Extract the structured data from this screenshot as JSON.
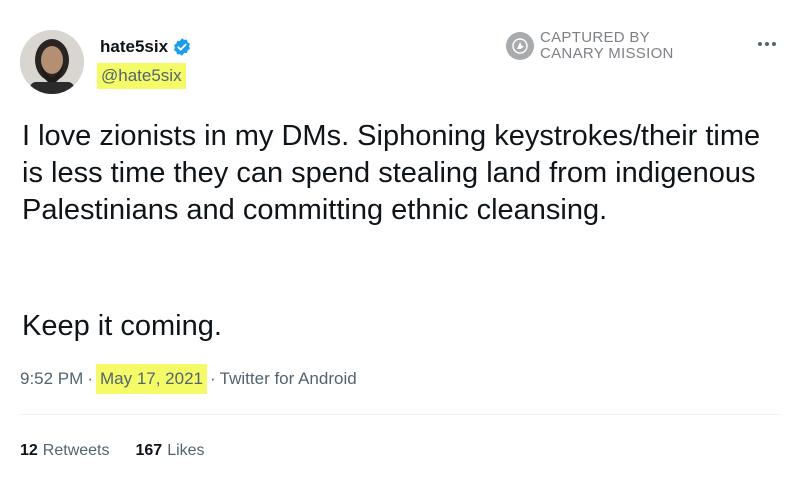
{
  "tweet": {
    "author": {
      "display_name": "hate5six",
      "handle": "@hate5six",
      "verified": true,
      "verified_icon": "verified-badge-icon",
      "verified_color": "#1d9bf0"
    },
    "watermark": {
      "line1": "CAPTURED BY",
      "line2": "CANARY MISSION",
      "icon": "canary-bird-icon"
    },
    "more_icon": "ellipsis-icon",
    "text_paragraph_1": "I love zionists in my DMs. Siphoning keystrokes/their time is less time they can spend stealing land from indigenous Palestinians and committing ethnic cleansing.",
    "text_paragraph_2": "Keep it coming.",
    "meta": {
      "time": "9:52 PM",
      "sep1": "·",
      "date": "May 17, 2021",
      "sep2": "·",
      "source": "Twitter for Android"
    },
    "stats": {
      "retweets_count": "12",
      "retweets_label": "Retweets",
      "likes_count": "167",
      "likes_label": "Likes"
    },
    "highlight_color": "#f4fb66"
  }
}
